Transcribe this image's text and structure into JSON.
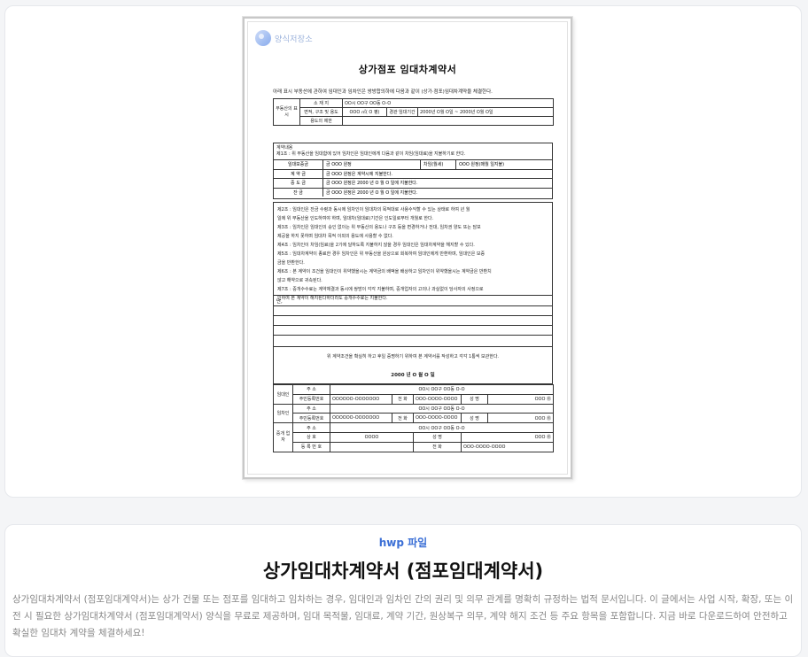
{
  "preview": {
    "watermark": "양식저장소",
    "doc_title": "상가점포 임대차계약서",
    "intro": "아래 표시 부동산에 관하여 임대인과 임차인은 쌍방합의하에 다음과 같이 (상가·점포)임대차계약을 체결한다.",
    "property": {
      "group_label": "부동산의 표 시",
      "location_label": "소 재 지",
      "location_value": "OO시 OO구 OO동 O-O",
      "area_label": "면적, 구조 및 용도",
      "area_value": "OOO ㎡( O 평)",
      "term_label": "경관 임대기간",
      "term_value": "2000년 O월 O일 ~ 2000년 O월 O일",
      "restriction_label": "용도의 제한"
    },
    "payment": {
      "head": "계약내용\n제1조 : 위 부동산을 임대함에 있어 임차인은 임대인에게 다음과 같이 차임(임대료)을 지불하기로 한다.",
      "deposit_label": "임대보증금",
      "deposit_value": "금 OOO 원정",
      "rent_label": "차임(월세)",
      "rent_value": "OOO 원정(매월    일지불)",
      "contract_label": "계 약 금",
      "contract_value": "금 OOO 원정은 계약시에 지불한다.",
      "middle_label": "중 도 금",
      "middle_value": "금 OOO 원정은 2000 년   O 월   O 일에 지불한다.",
      "balance_label": "잔       금",
      "balance_value": "금 OOO 원정은 2000 년   O 월   O 일에 지불한다."
    },
    "terms": [
      "제2조 : 임대인은 잔금 수령과 동시에 임차인이 임대차의 목적대로 사용수익할 수 있는 상태로 하여      년    월",
      "         일에 위 부동산을 인도하여야 하며, 임대차(임대료)기간은 인도일로부터    개월로 한다.",
      "제3조 : 임차인은 임대인의 승인 없이는 위 부동산의 용도나 구조 등을 변경하거나 전대, 임차권 양도 또는 담보",
      "         제공을 하지 못하며 임대차 목적 이외의 용도에 사용할 수 없다.",
      "제4조 : 임차인이 차임(임료)을 2기에 달하도록 지불하지 않을 경우 임대인은 임대차계약을 해지할 수 있다.",
      "제5조 : 임대차계약이 종료한 경우 임차인은 위 부동산을 원상으로 회복하여 임대인에게 반환하며, 임대인은 보증",
      "         금을 반환한다.",
      "제6조 : 본 계약이 조건을 임대인이 위약했을시는 계약금의 배액을 배상하고 임차인이 위약했을시는 계약금은 반환치",
      "         않고 해약으로 귀속된다.",
      "제7조 : 중개수수료는 계약체결과 동시에 쌍방이 각각 지불하며, 중개업자의 고의나 과실없이 당사자의 사정으로",
      "         인하여 본 계약이 해지된다하더라도 중개수수료는 지불한다."
    ],
    "special_head": "단,",
    "closing_text": "위 계약조건을 확실히 하고 후일 증명하기 위하여 본 계약서를 작성하고 각각 1통씩 보관한다.",
    "closing_date": "2000 년   O 월   O 일",
    "parties": {
      "lessor_label": "임대인",
      "lessee_label": "임차인",
      "agent_label": "중개 업자",
      "address_label": "주         소",
      "address_value": "OO시 OO구 OO동 O-O",
      "id_label": "주민등록번호",
      "id_value": "OOOOOO-OOOOOOO",
      "phone_label": "전  화",
      "phone_value": "OOO-OOOO-OOOO",
      "name_label": "성  명",
      "name_value": "OOO ㊞",
      "trade_label": "상       호",
      "trade_value": "OOOO",
      "reg_label": "등 록 번 호"
    }
  },
  "info": {
    "tag": "hwp 파일",
    "title": "상가임대차계약서 (점포임대계약서)",
    "description": "상가임대차계약서 (점포임대계약서)는 상가 건물 또는 점포를 임대하고 임차하는 경우, 임대인과 임차인 간의 권리 및 의무 관계를 명확히 규정하는 법적 문서입니다. 이 글에서는 사업 시작, 확장, 또는 이전 시 필요한 상가임대차계약서 (점포임대계약서) 양식을 무료로 제공하며, 임대 목적물, 임대료, 계약 기간, 원상복구 의무, 계약 해지 조건 등 주요 항목을 포함합니다. 지금 바로 다운로드하여 안전하고 확실한 임대차 계약을 체결하세요!"
  }
}
